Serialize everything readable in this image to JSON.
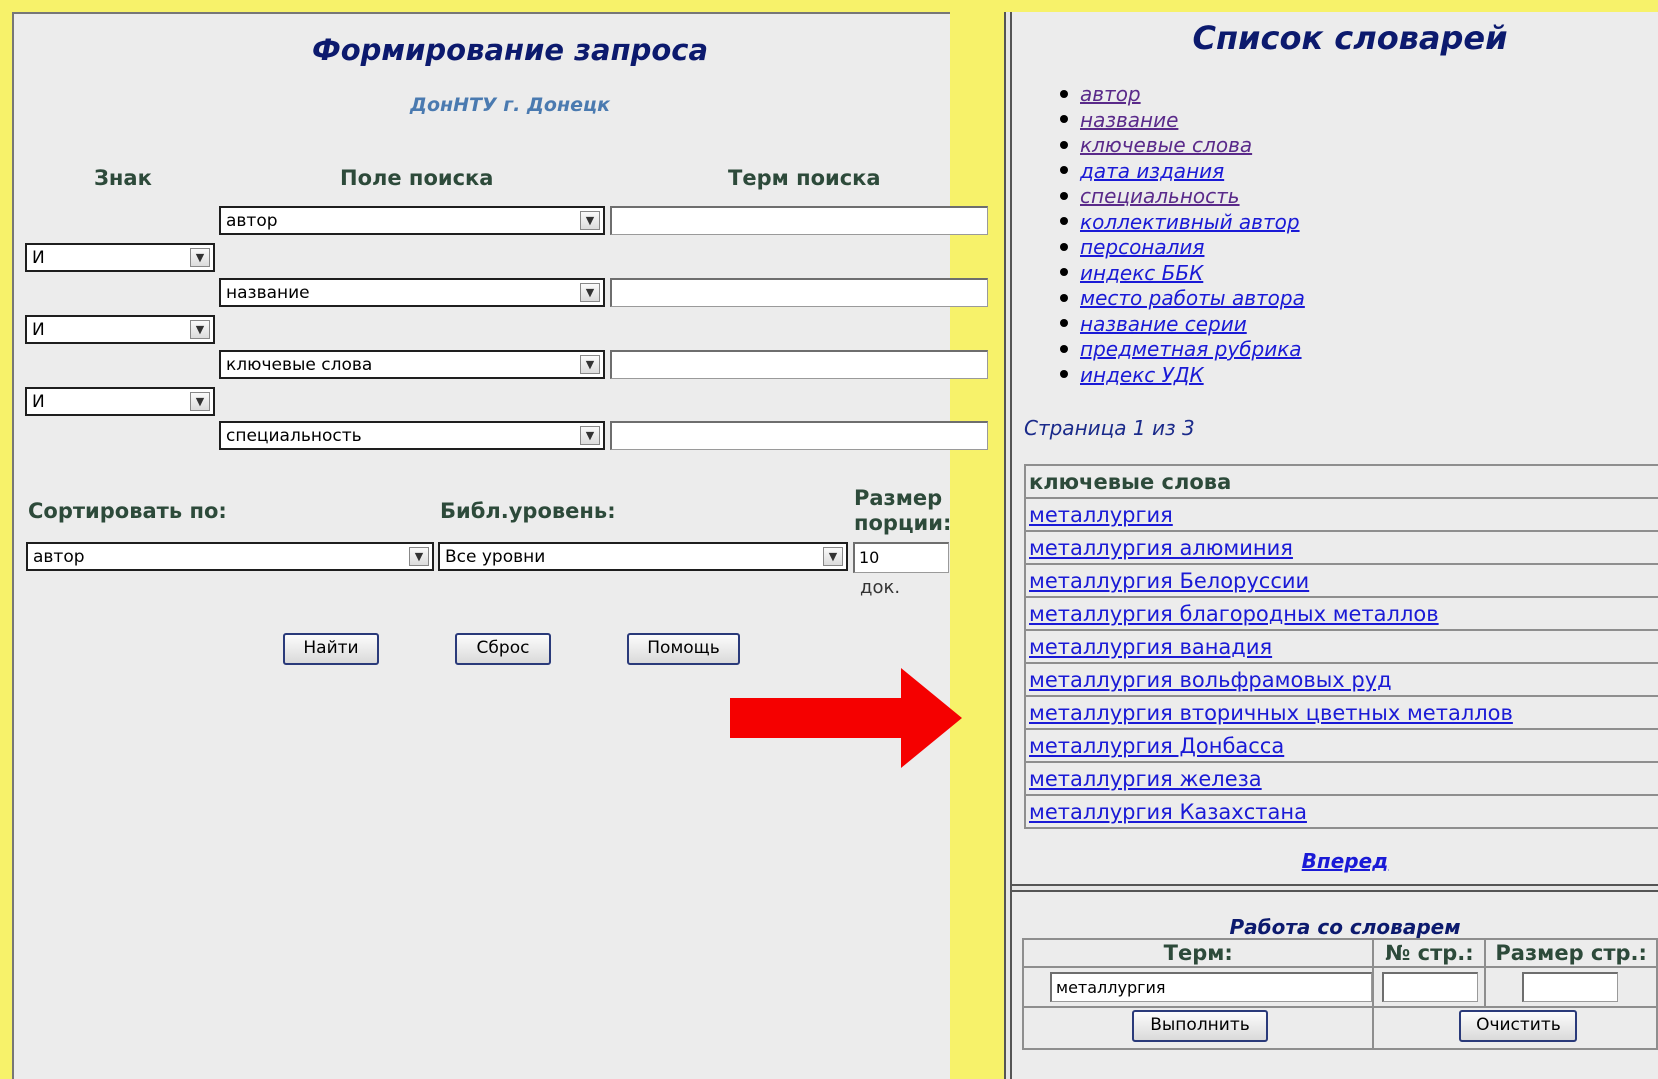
{
  "left": {
    "title": "Формирование запроса",
    "subtitle": "ДонНТУ г. Донецк",
    "col_headers": {
      "sign": "Знак",
      "field": "Поле поиска",
      "term": "Терм поиска"
    },
    "rows": [
      {
        "field": "автор",
        "term": ""
      },
      {
        "sign": "И",
        "field": "название",
        "term": ""
      },
      {
        "sign": "И",
        "field": "ключевые слова",
        "term": ""
      },
      {
        "sign": "И",
        "field": "специальность",
        "term": ""
      }
    ],
    "sort_label": "Сортировать по:",
    "sort_value": "автор",
    "level_label": "Библ.уровень:",
    "level_value": "Все уровни",
    "portion_label_1": "Размер",
    "portion_label_2": "порции:",
    "portion_value": "10",
    "portion_unit": "док.",
    "buttons": {
      "find": "Найти",
      "reset": "Сброс",
      "help": "Помощь"
    }
  },
  "right": {
    "title": "Список словарей",
    "dictionaries": [
      "автор",
      "название",
      "ключевые слова",
      "дата издания",
      "специальность",
      "коллективный автор",
      "персоналия",
      "индекс ББК",
      "место работы автора",
      "название серии",
      "предметная рубрика",
      "индекс УДК"
    ],
    "page_info": "Страница 1 из 3",
    "table_header": "ключевые слова",
    "entries": [
      "металлургия",
      "металлургия алюминия",
      "металлургия Белоруссии",
      "металлургия благородных металлов",
      "металлургия ванадия",
      "металлургия вольфрамовых руд",
      "металлургия вторичных цветных металлов",
      "металлургия Донбасса",
      "металлургия железа",
      "металлургия Казахстана"
    ],
    "next": "Вперед",
    "work": {
      "title": "Работа со словарем",
      "term_header": "Терм:",
      "page_header": "№ стр.:",
      "size_header": "Размер стр.:",
      "term_value": "металлургия",
      "page_value": "",
      "size_value": "",
      "execute": "Выполнить",
      "clear": "Очистить"
    }
  },
  "colors": {
    "frame_yellow": "#f7f26a",
    "arrow_red": "#f50000",
    "title_navy": "#0c1a6e",
    "link_blue": "#1a1ad6"
  }
}
